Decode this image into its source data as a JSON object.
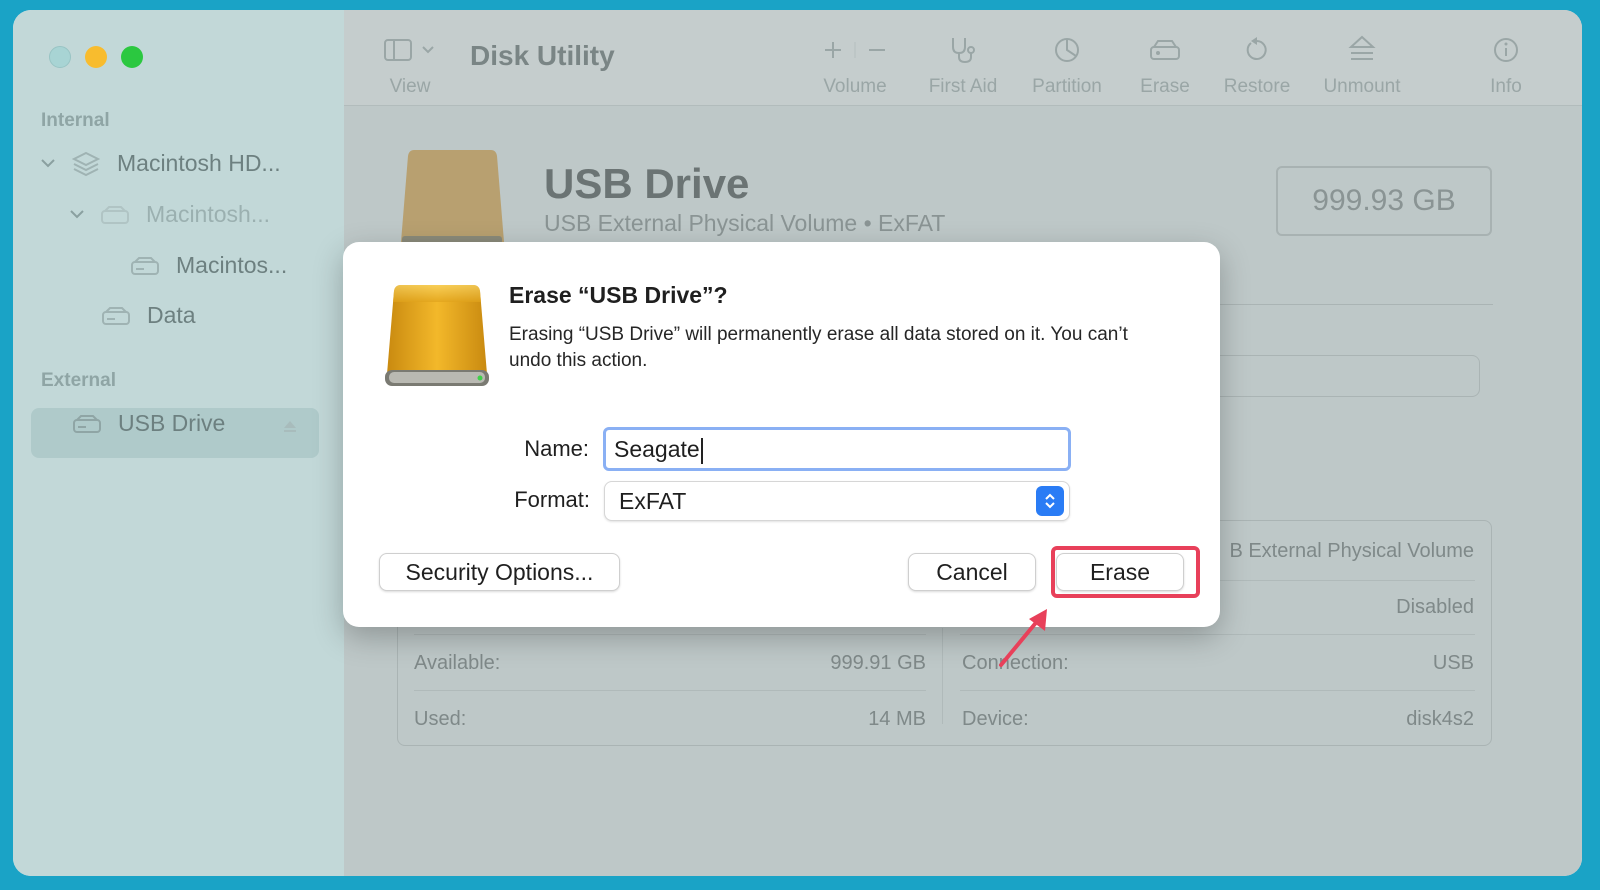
{
  "sidebar": {
    "sections": {
      "internal": "Internal",
      "external": "External"
    },
    "items": [
      {
        "label": "Macintosh HD..."
      },
      {
        "label": "Macintosh..."
      },
      {
        "label": "Macintos..."
      },
      {
        "label": "Data"
      },
      {
        "label": "USB Drive"
      }
    ]
  },
  "toolbar": {
    "view_label": "View",
    "title": "Disk Utility",
    "volume_label": "Volume",
    "first_aid_label": "First Aid",
    "partition_label": "Partition",
    "erase_label": "Erase",
    "restore_label": "Restore",
    "unmount_label": "Unmount",
    "info_label": "Info"
  },
  "disk": {
    "name": "USB Drive",
    "subtitle": "USB External Physical Volume • ExFAT",
    "capacity": "999.93 GB"
  },
  "info": {
    "type_value": "B External Physical Volume",
    "owners_value": "Disabled",
    "available_label": "Available:",
    "available_value": "999.91 GB",
    "used_label": "Used:",
    "used_value": "14 MB",
    "connection_label": "Connection:",
    "connection_value": "USB",
    "device_label": "Device:",
    "device_value": "disk4s2"
  },
  "dialog": {
    "title": "Erase “USB Drive”?",
    "message": "Erasing “USB Drive” will permanently erase all data stored on it. You can’t undo this action.",
    "name_label": "Name:",
    "name_value": "Seagate",
    "format_label": "Format:",
    "format_value": "ExFAT",
    "security_button": "Security Options...",
    "cancel_button": "Cancel",
    "erase_button": "Erase"
  },
  "colors": {
    "background": "#1aa3c6",
    "highlight": "#e8405a",
    "accent": "#2a7cf5",
    "drive_gold": "#e0a21a"
  }
}
